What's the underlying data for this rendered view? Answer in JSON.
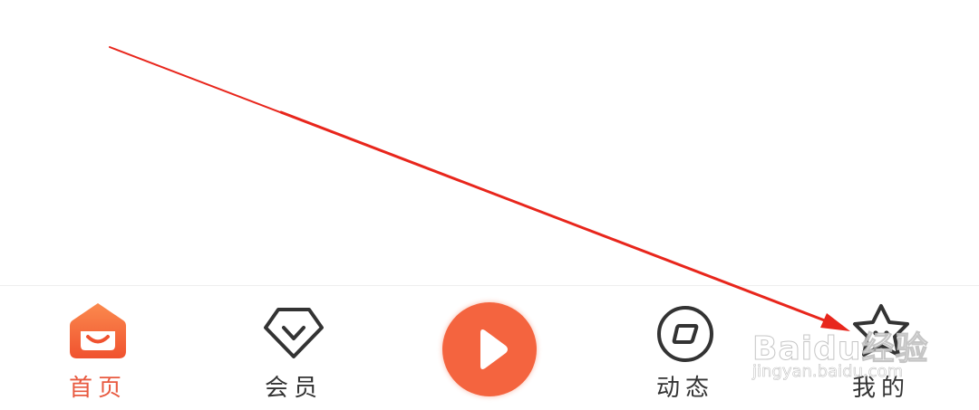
{
  "tabbar": {
    "tabs": [
      {
        "id": "home",
        "label": "首页",
        "icon": "home-icon",
        "active": true
      },
      {
        "id": "vip",
        "label": "会员",
        "icon": "diamond-icon",
        "active": false
      },
      {
        "id": "play",
        "label": "",
        "icon": "play-icon",
        "active": false
      },
      {
        "id": "feed",
        "label": "动态",
        "icon": "moments-icon",
        "active": false
      },
      {
        "id": "mine",
        "label": "我的",
        "icon": "star-face-icon",
        "active": false
      }
    ]
  },
  "watermark": {
    "logo": "Baidu经验",
    "url": "jingyan.baidu.com"
  },
  "colors": {
    "accent": "#f4643f",
    "active_label": "#e85a40",
    "annotation_arrow": "#e8261c",
    "inactive": "#333333"
  }
}
